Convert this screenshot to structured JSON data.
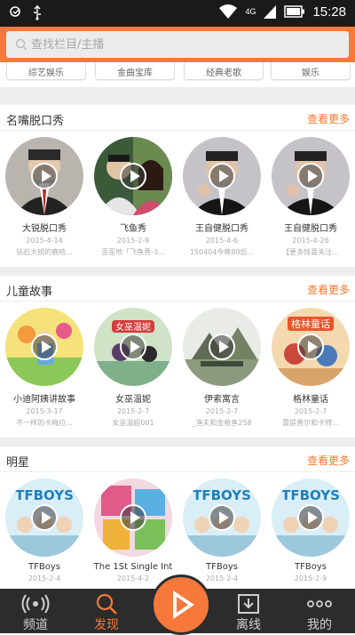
{
  "status_bar": {
    "time": "15:28",
    "network": "4G"
  },
  "search": {
    "placeholder": "查找栏目/主播"
  },
  "chips": [
    "综艺娱乐",
    "金曲宝库",
    "经典老歌",
    "娱乐"
  ],
  "sections": [
    {
      "title": "名嘴脱口秀",
      "more": "查看更多",
      "items": [
        {
          "title": "大锐脱口秀",
          "date": "2015-4-14",
          "desc": "钻石大锐的鹿晗..."
        },
        {
          "title": "飞鱼秀",
          "date": "2015-2-9",
          "desc": "歪歪地「飞鱼秀-3..."
        },
        {
          "title": "王自健脱口秀",
          "date": "2015-4-6",
          "desc": "150404今晚80后..."
        },
        {
          "title": "王自健脱口秀",
          "date": "2015-4-26",
          "desc": "【更多惊喜关注..."
        }
      ]
    },
    {
      "title": "儿童故事",
      "more": "查看更多",
      "items": [
        {
          "title": "小迪阿姨讲故事",
          "date": "2015-3-17",
          "desc": "不一样的卡梅拉..."
        },
        {
          "title": "女巫温妮",
          "date": "2015-2-7",
          "desc": "女巫温妮001"
        },
        {
          "title": "伊索寓言",
          "date": "2015-2-7",
          "desc": "_渔夫和金枪鱼258"
        },
        {
          "title": "格林童话",
          "date": "2015-2-7",
          "desc": "蕾提普尔和卡特..."
        }
      ]
    },
    {
      "title": "明星",
      "more": "查看更多",
      "items": [
        {
          "title": "TFBoys",
          "date": "2015-2-4",
          "desc": ""
        },
        {
          "title": "The 1St Single Int",
          "date": "2015-4-2",
          "desc": ""
        },
        {
          "title": "TFBoys",
          "date": "2015-2-4",
          "desc": ""
        },
        {
          "title": "TFBoys",
          "date": "2015-2-9",
          "desc": ""
        }
      ]
    }
  ],
  "tabs": [
    "频道",
    "发现",
    "离线",
    "我的"
  ],
  "art_text": {
    "book_title_2": "女巫温妮",
    "book_title_4": "格林童话",
    "band": "TFBOYS"
  },
  "colors": {
    "accent": "#f6793b",
    "tab_bar": "#2c2c2c"
  }
}
